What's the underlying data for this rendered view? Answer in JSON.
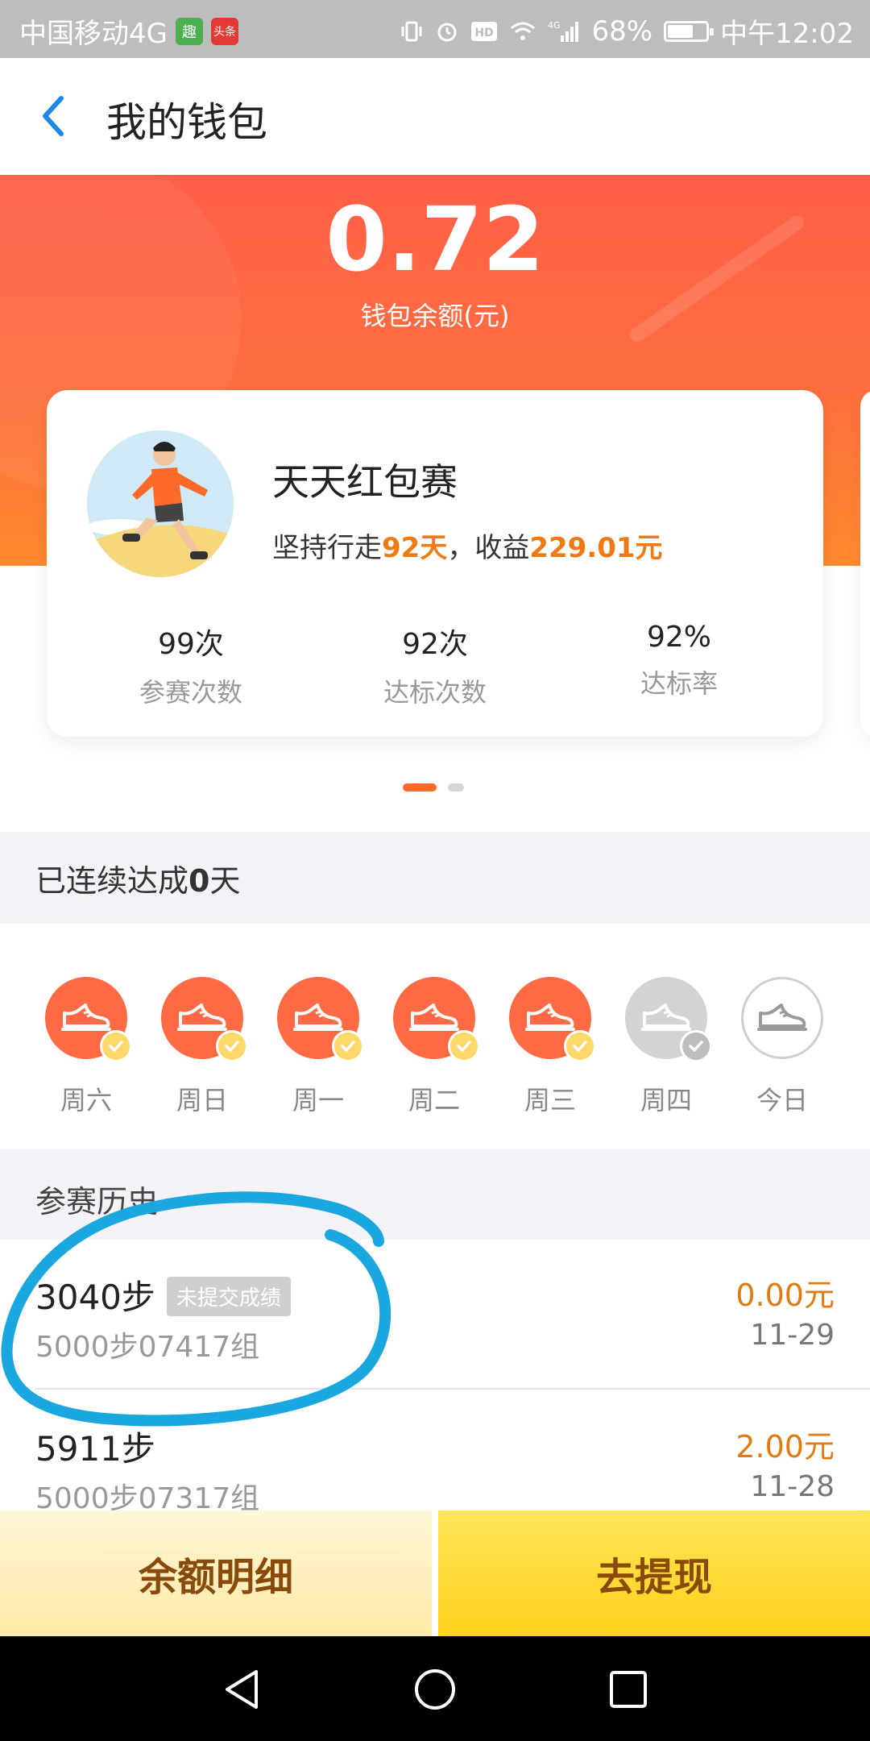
{
  "status_bar": {
    "carrier": "中国移动4G",
    "badge1": "趣",
    "badge2": "头条",
    "network": "4G",
    "battery": "68%",
    "battery_level": 0.68,
    "time": "中午12:02"
  },
  "header": {
    "title": "我的钱包"
  },
  "wallet": {
    "balance": "0.72",
    "balance_label": "钱包余额(元)"
  },
  "card": {
    "title": "天天红包赛",
    "sub_prefix": "坚持行走",
    "days": "92天",
    "sub_mid": "，收益",
    "earnings": "229.01元",
    "stats": [
      {
        "value": "99次",
        "label": "参赛次数"
      },
      {
        "value": "92次",
        "label": "达标次数"
      },
      {
        "value": "92%",
        "label": "达标率"
      }
    ]
  },
  "pager": {
    "active_index": 0,
    "count": 2
  },
  "streak": {
    "prefix": "已连续达成",
    "count": "0",
    "suffix": "天"
  },
  "days": [
    {
      "label": "周六",
      "state": "done"
    },
    {
      "label": "周日",
      "state": "done"
    },
    {
      "label": "周一",
      "state": "done"
    },
    {
      "label": "周二",
      "state": "done"
    },
    {
      "label": "周三",
      "state": "done"
    },
    {
      "label": "周四",
      "state": "missed"
    },
    {
      "label": "今日",
      "state": "today"
    }
  ],
  "history": {
    "title": "参赛历史",
    "rows": [
      {
        "steps": "3040步",
        "tag": "未提交成绩",
        "group": "5000步07417组",
        "amount": "0.00元",
        "date": "11-29"
      },
      {
        "steps": "5911步",
        "tag": "",
        "group": "5000步07317组",
        "amount": "2.00元",
        "date": "11-28"
      }
    ]
  },
  "buttons": {
    "left": "余额明细",
    "right": "去提现"
  },
  "colors": {
    "accent_orange": "#ff6a45",
    "highlight": "#f07a12",
    "amount": "#e07b13",
    "done_check": "#ffd86a",
    "annotation": "#1aa7e0"
  }
}
